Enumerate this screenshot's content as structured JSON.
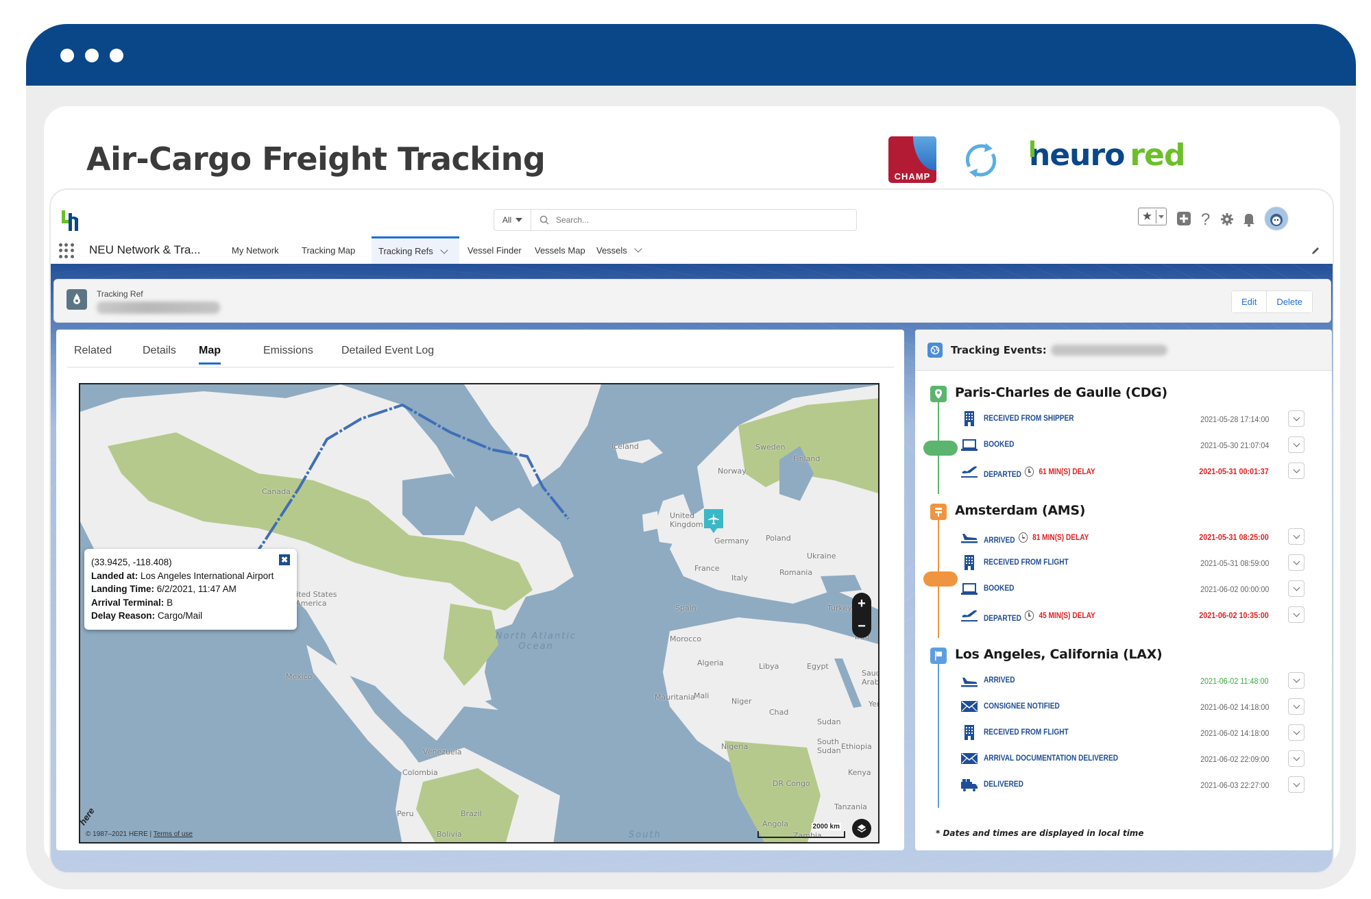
{
  "frame": {
    "window_dots": 3
  },
  "header": {
    "title": "Air-Cargo Freight Tracking",
    "logos": {
      "champ": "CHAMP",
      "neurored_part1": "neuro",
      "neurored_part2": "red"
    }
  },
  "app": {
    "search": {
      "scope": "All",
      "placeholder": "Search..."
    },
    "app_name": "NEU Network & Tra...",
    "nav": [
      {
        "label": "My Network",
        "active": false,
        "dropdown": false
      },
      {
        "label": "Tracking Map",
        "active": false,
        "dropdown": false
      },
      {
        "label": "Tracking Refs",
        "active": true,
        "dropdown": true
      },
      {
        "label": "Vessel Finder",
        "active": false,
        "dropdown": false
      },
      {
        "label": "Vessels Map",
        "active": false,
        "dropdown": false
      },
      {
        "label": "Vessels",
        "active": false,
        "dropdown": true
      }
    ],
    "utility_icons": [
      "favorites-icon",
      "add-icon",
      "help-icon",
      "settings-icon",
      "notifications-icon",
      "avatar"
    ]
  },
  "record": {
    "type_label": "Tracking Ref",
    "value_redacted": "[redacted]",
    "actions": {
      "edit": "Edit",
      "delete": "Delete"
    }
  },
  "tabs": [
    {
      "label": "Related",
      "active": false
    },
    {
      "label": "Details",
      "active": false
    },
    {
      "label": "Map",
      "active": true
    },
    {
      "label": "Emissions",
      "active": false
    },
    {
      "label": "Detailed Event Log",
      "active": false
    }
  ],
  "map": {
    "popup": {
      "coords": "(33.9425, -118.408)",
      "landed_at_label": "Landed at:",
      "landed_at": "Los Angeles International Airport",
      "landing_time_label": "Landing Time:",
      "landing_time": "6/2/2021, 11:47 AM",
      "terminal_label": "Arrival Terminal:",
      "terminal": "B",
      "delay_label": "Delay Reason:",
      "delay": "Cargo/Mail"
    },
    "country_labels": [
      "Canada",
      "United States of America",
      "Mexico",
      "Venezuela",
      "Colombia",
      "Peru",
      "Brazil",
      "Bolivia",
      "Iceland",
      "Norway",
      "Sweden",
      "Finland",
      "United Kingdom",
      "Germany",
      "Poland",
      "Ukraine",
      "France",
      "Italy",
      "Romania",
      "Spain",
      "Turkey",
      "Iraq",
      "Morocco",
      "Algeria",
      "Libya",
      "Egypt",
      "Mauritania",
      "Mali",
      "Niger",
      "Chad",
      "Sudan",
      "Nigeria",
      "South Sudan",
      "Ethiopia",
      "Kenya",
      "DR Congo",
      "Tanzania",
      "Angola",
      "Zambia",
      "Saudi Arabia",
      "Yemen"
    ],
    "ocean_labels": [
      "North Atlantic Ocean",
      "South"
    ],
    "attribution": "© 1987–2021 HERE |",
    "terms_link": "Terms of use",
    "scale": "2000 km",
    "zoom_in": "+",
    "zoom_out": "−",
    "route_color": "#3f6fb8",
    "marker_color": "#3bb8c8"
  },
  "events_panel": {
    "title": "Tracking Events:",
    "ref_redacted": "[redacted]",
    "stations": [
      {
        "name": "Paris-Charles de Gaulle (CDG)",
        "color": "#5bb56e",
        "icon": "map-pin-icon",
        "events": [
          {
            "icon": "building-icon",
            "label": "RECEIVED FROM SHIPPER",
            "delay": "",
            "time": "2021-05-28 17:14:00",
            "status": "normal"
          },
          {
            "icon": "laptop-icon",
            "label": "BOOKED",
            "delay": "",
            "time": "2021-05-30 21:07:04",
            "status": "normal"
          },
          {
            "icon": "plane-takeoff-icon",
            "label": "DEPARTED",
            "delay": "61 MIN(S) DELAY",
            "time": "2021-05-31 00:01:37",
            "status": "late"
          }
        ]
      },
      {
        "name": "Amsterdam (AMS)",
        "color": "#f0953f",
        "icon": "signpost-icon",
        "events": [
          {
            "icon": "plane-landing-icon",
            "label": "ARRIVED",
            "delay": "81 MIN(S) DELAY",
            "time": "2021-05-31 08:25:00",
            "status": "late"
          },
          {
            "icon": "building-icon",
            "label": "RECEIVED FROM FLIGHT",
            "delay": "",
            "time": "2021-05-31 08:59:00",
            "status": "normal"
          },
          {
            "icon": "laptop-icon",
            "label": "BOOKED",
            "delay": "",
            "time": "2021-06-02 00:00:00",
            "status": "normal"
          },
          {
            "icon": "plane-takeoff-icon",
            "label": "DEPARTED",
            "delay": "45 MIN(S) DELAY",
            "time": "2021-06-02 10:35:00",
            "status": "late"
          }
        ]
      },
      {
        "name": "Los Angeles, California (LAX)",
        "color": "#5d9ee0",
        "icon": "flag-icon",
        "events": [
          {
            "icon": "plane-landing-icon",
            "label": "ARRIVED",
            "delay": "",
            "time": "2021-06-02 11:48:00",
            "status": "ontime"
          },
          {
            "icon": "envelope-icon",
            "label": "CONSIGNEE NOTIFIED",
            "delay": "",
            "time": "2021-06-02 14:18:00",
            "status": "normal"
          },
          {
            "icon": "building-icon",
            "label": "RECEIVED FROM FLIGHT",
            "delay": "",
            "time": "2021-06-02 14:18:00",
            "status": "normal"
          },
          {
            "icon": "envelope-icon",
            "label": "ARRIVAL DOCUMENTATION DELIVERED",
            "delay": "",
            "time": "2021-06-02 22:09:00",
            "status": "normal"
          },
          {
            "icon": "truck-icon",
            "label": "DELIVERED",
            "delay": "",
            "time": "2021-06-03 22:27:00",
            "status": "normal"
          }
        ]
      }
    ],
    "footnote": "* Dates and times are displayed in local time"
  }
}
